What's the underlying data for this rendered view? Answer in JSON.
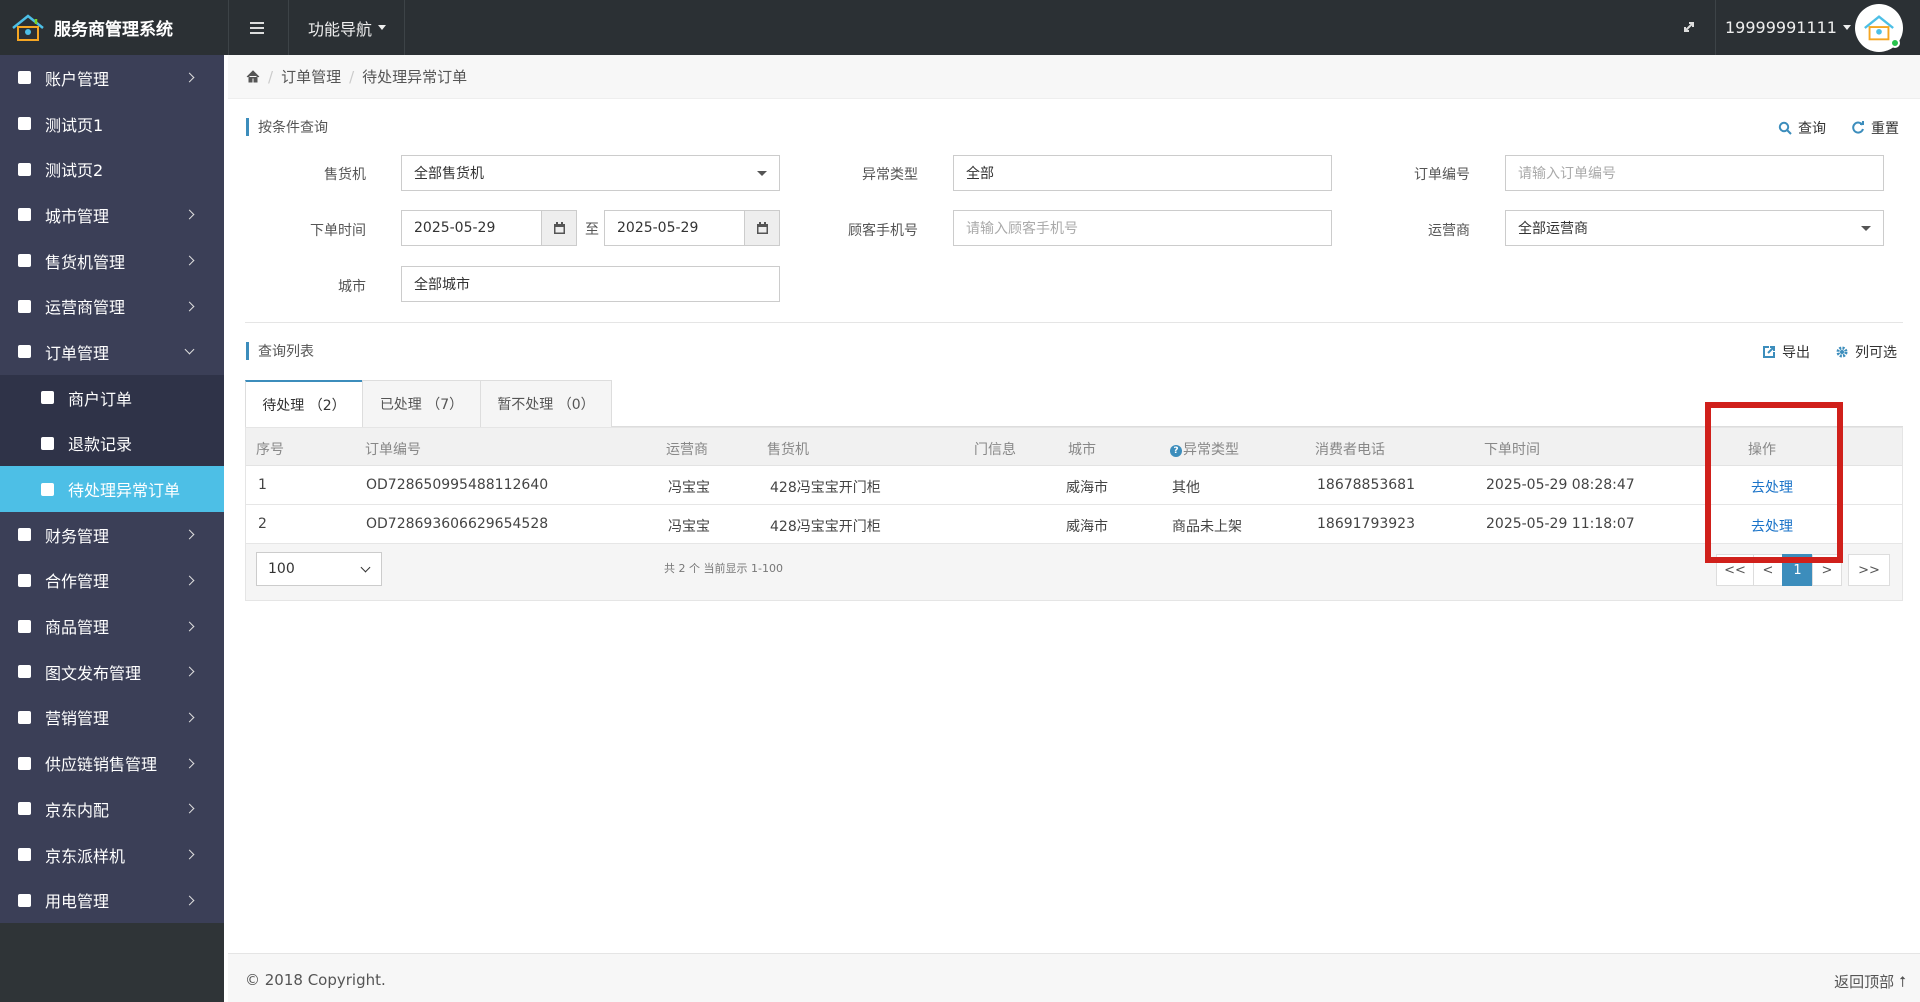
{
  "app": {
    "title": "服务商管理系统",
    "function_nav": "功能导航",
    "user": "19999991111"
  },
  "sidebar": {
    "items": [
      {
        "label": "账户管理",
        "arrow": "right"
      },
      {
        "label": "测试页1",
        "arrow": ""
      },
      {
        "label": "测试页2",
        "arrow": ""
      },
      {
        "label": "城市管理",
        "arrow": "right"
      },
      {
        "label": "售货机管理",
        "arrow": "right"
      },
      {
        "label": "运营商管理",
        "arrow": "right"
      },
      {
        "label": "订单管理",
        "arrow": "down"
      },
      {
        "label": "商户订单",
        "sub": true
      },
      {
        "label": "退款记录",
        "sub": true
      },
      {
        "label": "待处理异常订单",
        "sub": true,
        "active": true
      },
      {
        "label": "财务管理",
        "arrow": "right"
      },
      {
        "label": "合作管理",
        "arrow": "right"
      },
      {
        "label": "商品管理",
        "arrow": "right"
      },
      {
        "label": "图文发布管理",
        "arrow": "right"
      },
      {
        "label": "营销管理",
        "arrow": "right"
      },
      {
        "label": "供应链销售管理",
        "arrow": "right"
      },
      {
        "label": "京东内配",
        "arrow": "right"
      },
      {
        "label": "京东派样机",
        "arrow": "right"
      },
      {
        "label": "用电管理",
        "arrow": "right"
      }
    ]
  },
  "breadcrumb": {
    "level1": "订单管理",
    "level2": "待处理异常订单"
  },
  "filter": {
    "title": "按条件查询",
    "query": "查询",
    "reset": "重置",
    "vending_label": "售货机",
    "vending_value": "全部售货机",
    "exception_label": "异常类型",
    "exception_value": "全部",
    "order_no_label": "订单编号",
    "order_no_placeholder": "请输入订单编号",
    "time_label": "下单时间",
    "start_date": "2025-05-29",
    "to": "至",
    "end_date": "2025-05-29",
    "phone_label": "顾客手机号",
    "phone_placeholder": "请输入顾客手机号",
    "operator_label": "运营商",
    "operator_value": "全部运营商",
    "city_label": "城市",
    "city_value": "全部城市"
  },
  "list": {
    "title": "查询列表",
    "export": "导出",
    "columns_btn": "列可选",
    "tabs": [
      {
        "label": "待处理 （2）"
      },
      {
        "label": "已处理 （7）"
      },
      {
        "label": "暂不处理 （0）"
      }
    ],
    "headers": [
      "序号",
      "订单编号",
      "运营商",
      "售货机",
      "门信息",
      "城市",
      "异常类型",
      "消费者电话",
      "下单时间",
      "操作"
    ],
    "rows": [
      [
        "1",
        "OD728650995488112640",
        "冯宝宝",
        "428冯宝宝开门柜",
        "",
        "威海市",
        "其他",
        "18678853681",
        "2025-05-29 08:28:47",
        "去处理"
      ],
      [
        "2",
        "OD728693606629654528",
        "冯宝宝",
        "428冯宝宝开门柜",
        "",
        "威海市",
        "商品未上架",
        "18691793923",
        "2025-05-29 11:18:07",
        "去处理"
      ]
    ],
    "page_size": "100",
    "page_info": "共 2 个 当前显示 1-100",
    "pager": [
      "<<",
      "<",
      "1",
      ">",
      ">>"
    ]
  },
  "footer": {
    "copyright": "© 2018 Copyright.",
    "back_top": "返回顶部"
  },
  "colors": {
    "accent": "#3c8dbc",
    "active_menu": "#4dbfe6",
    "highlight": "#d0201b"
  }
}
